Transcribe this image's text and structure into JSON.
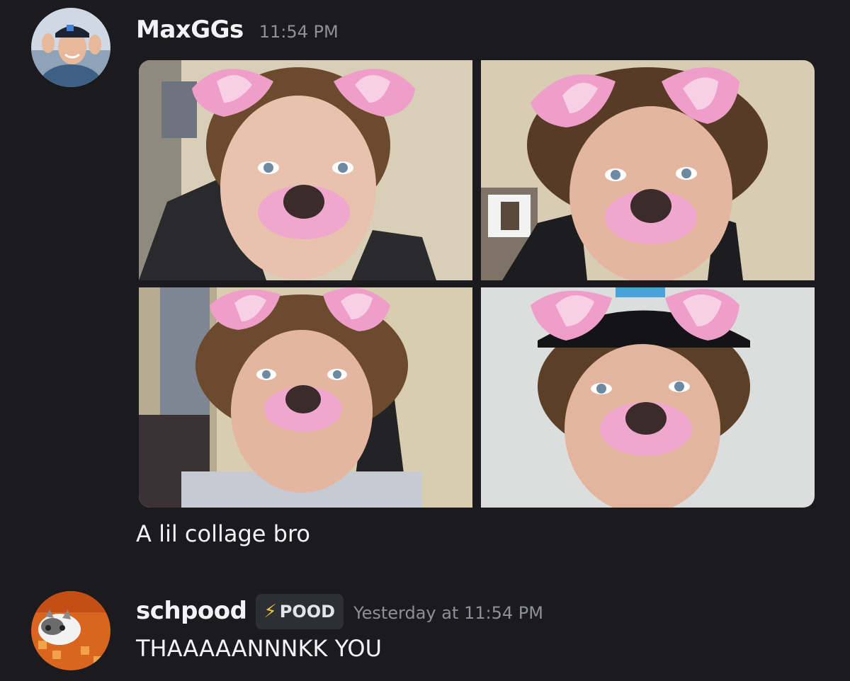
{
  "messages": [
    {
      "username": "MaxGGs",
      "timestamp": "11:54 PM",
      "attachments": [
        {
          "name": "collage-photo-1"
        },
        {
          "name": "collage-photo-2"
        },
        {
          "name": "collage-photo-3"
        },
        {
          "name": "collage-photo-4"
        }
      ],
      "text": "A lil collage bro"
    },
    {
      "username": "schpood",
      "tag": {
        "icon": "lightning-icon",
        "label": "POOD"
      },
      "timestamp": "Yesterday at 11:54 PM",
      "text": "THAAAAANNNKK YOU"
    }
  ],
  "colors": {
    "background": "#1b1b1f",
    "username": "#f2f3f5",
    "timestamp": "#8e9099",
    "tag_background": "#2e2f35",
    "tag_icon": "#e9c341",
    "filter_pink": "#f2a6d0"
  }
}
